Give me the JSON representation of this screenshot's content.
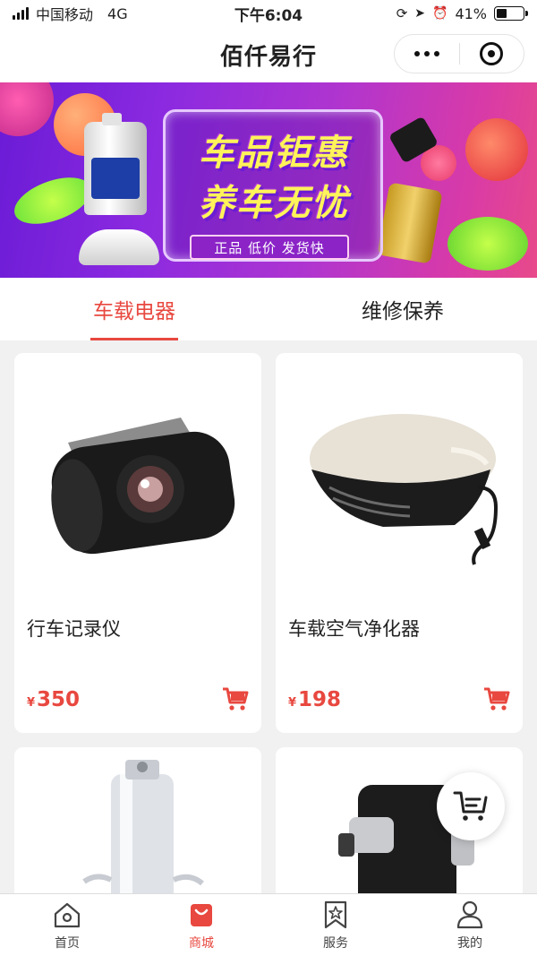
{
  "status_bar": {
    "carrier": "中国移动",
    "network": "4G",
    "time": "下午6:04",
    "battery": "41%",
    "battery_level": 0.41
  },
  "nav": {
    "title": "佰仟易行"
  },
  "banner": {
    "line1": "车品钜惠",
    "line2": "养车无忧",
    "tags": "正品  低价  发货快"
  },
  "tabs": [
    {
      "label": "车载电器",
      "active": true
    },
    {
      "label": "维修保养",
      "active": false
    }
  ],
  "products": [
    {
      "name": "行车记录仪",
      "currency": "¥",
      "price": "350",
      "image": "dashcam"
    },
    {
      "name": "车载空气净化器",
      "currency": "¥",
      "price": "198",
      "image": "air-purifier"
    },
    {
      "name": "",
      "currency": "",
      "price": "",
      "image": "car-charger"
    },
    {
      "name": "",
      "currency": "",
      "price": "",
      "image": "phone-holder"
    }
  ],
  "float_button": {
    "icon": "cart-list-icon"
  },
  "tabbar": [
    {
      "label": "首页",
      "icon": "home-icon",
      "active": false
    },
    {
      "label": "商城",
      "icon": "shop-bag-icon",
      "active": true
    },
    {
      "label": "服务",
      "icon": "bookmark-star-icon",
      "active": false
    },
    {
      "label": "我的",
      "icon": "user-icon",
      "active": false
    }
  ],
  "colors": {
    "accent": "#e8483f",
    "banner_start": "#6a1bd6",
    "banner_end": "#e84a8a"
  }
}
